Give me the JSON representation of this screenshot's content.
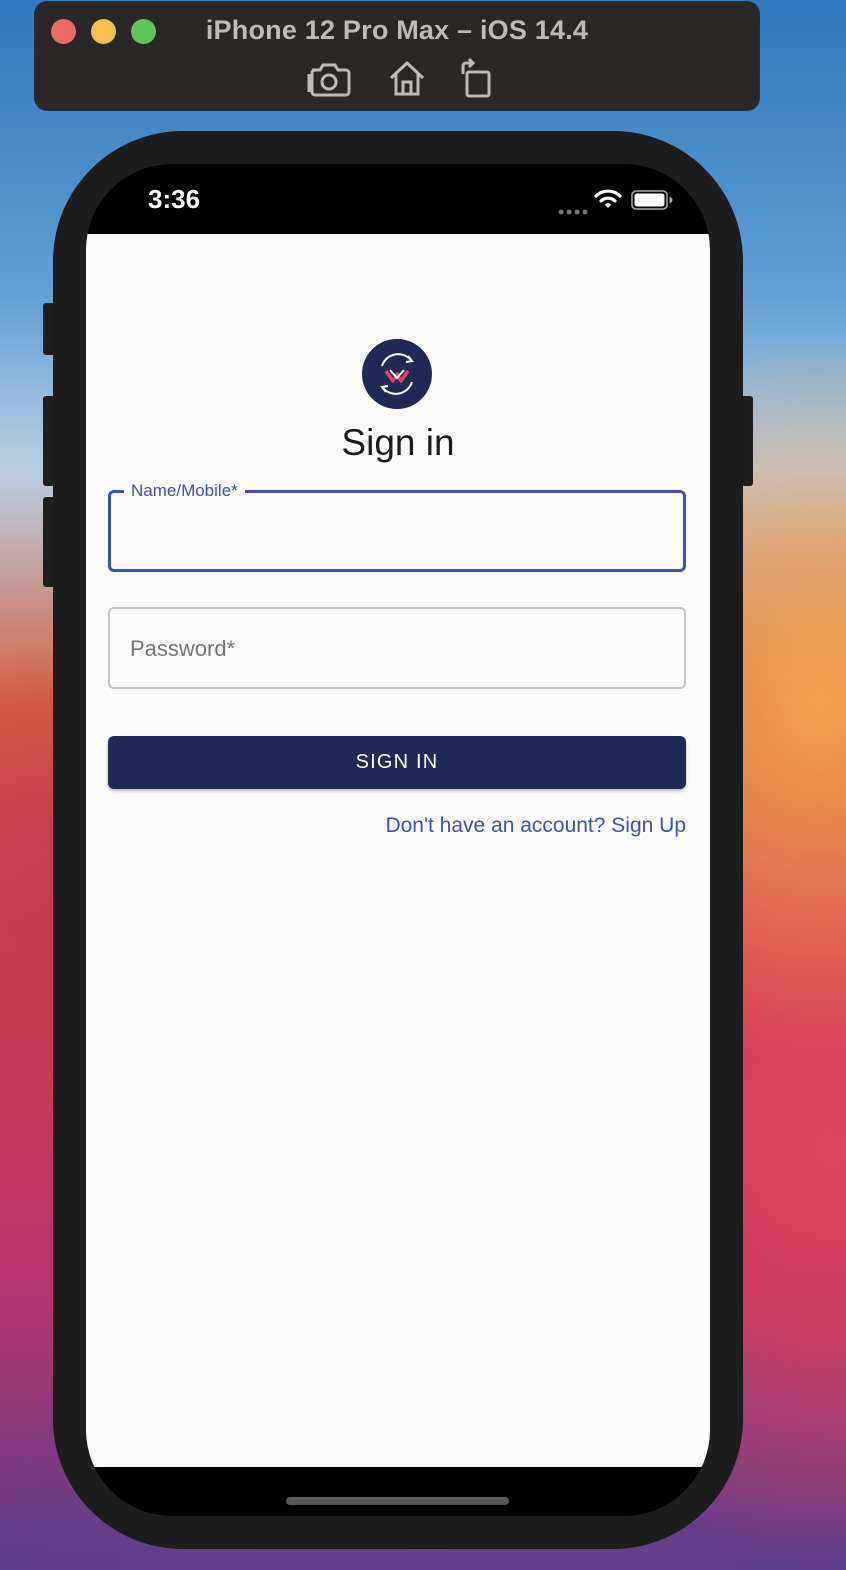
{
  "simulator": {
    "title": "iPhone 12 Pro Max – iOS 14.4",
    "tools": [
      {
        "name": "screenshot",
        "icon": "camera-icon"
      },
      {
        "name": "home",
        "icon": "home-icon"
      },
      {
        "name": "rotate",
        "icon": "rotate-icon"
      }
    ]
  },
  "status_bar": {
    "time": "3:36",
    "icons": [
      "signal-dots-icon",
      "wifi-icon",
      "battery-icon"
    ]
  },
  "app": {
    "logo_icon": "app-logo-icon",
    "title": "Sign in",
    "name_field": {
      "label": "Name/Mobile*",
      "value": ""
    },
    "password_field": {
      "placeholder": "Password*",
      "value": ""
    },
    "signin_button": "SIGN IN",
    "signup_link": "Don't have an account? Sign Up"
  },
  "colors": {
    "primary": "#1f2856",
    "accent": "#3f51b5",
    "background": "#fafafa"
  }
}
